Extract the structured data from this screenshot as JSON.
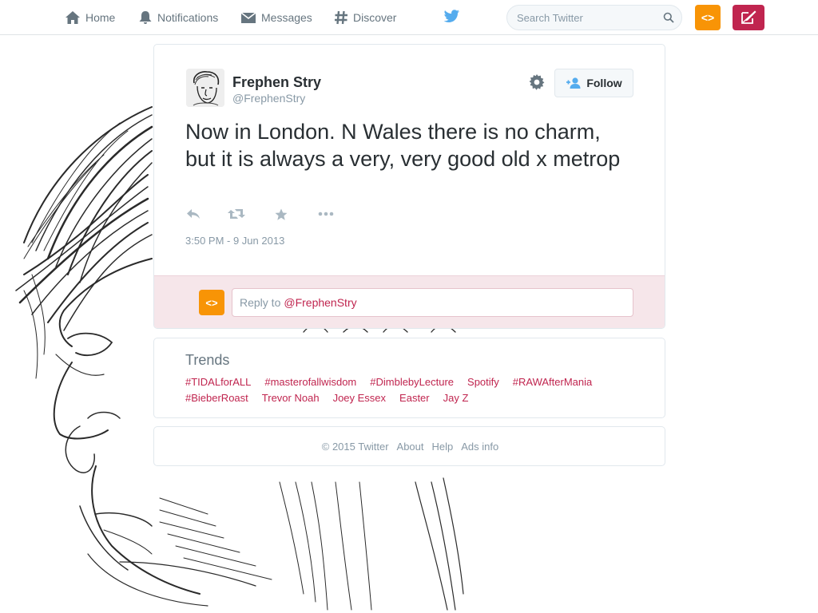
{
  "nav": {
    "home": "Home",
    "notifications": "Notifications",
    "messages": "Messages",
    "discover": "Discover",
    "search_placeholder": "Search Twitter",
    "code_label": "<>"
  },
  "icons": {
    "home": "home-icon",
    "notifications": "bell-icon",
    "messages": "envelope-icon",
    "discover": "hashtag-icon",
    "logo": "twitter-bird-icon",
    "search": "search-icon",
    "compose": "compose-icon",
    "settings": "gear-icon",
    "follow": "add-user-icon",
    "reply": "reply-icon",
    "retweet": "retweet-icon",
    "favorite": "star-icon",
    "more": "more-icon"
  },
  "colors": {
    "accent": "#c0254f",
    "code_button": "#f89406",
    "reply_background": "#f6e6ea",
    "bird": "#55acee"
  },
  "tweet": {
    "fullname": "Frephen Stry",
    "username": "@FrephenStry",
    "text": "Now in London. N Wales there is no charm, but it is always a very, very good old x metrop",
    "timestamp": "3:50 PM - 9 Jun 2013",
    "follow_label": "Follow"
  },
  "reply": {
    "avatar_label": "<>",
    "prefix": "Reply to",
    "mention": "@FrephenStry"
  },
  "trends": {
    "title": "Trends",
    "row1": [
      "#TIDALforALL",
      "#masterofallwisdom",
      "#DimblebyLecture",
      "Spotify",
      "#RAWAfterMania"
    ],
    "row2": [
      "#BieberRoast",
      "Trevor Noah",
      "Joey Essex",
      "Easter",
      "Jay Z"
    ]
  },
  "footer": {
    "copyright": "© 2015 Twitter",
    "about": "About",
    "help": "Help",
    "ads": "Ads info"
  }
}
